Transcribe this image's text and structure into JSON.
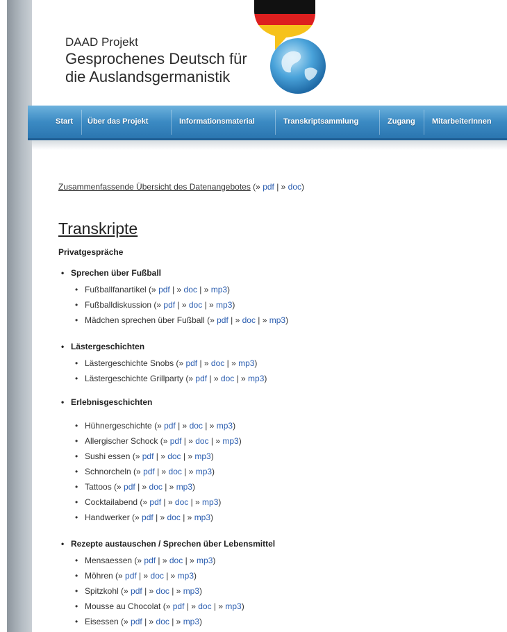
{
  "header": {
    "logo_line1": "DAAD Projekt",
    "logo_line2": "Gesprochenes Deutsch für",
    "logo_line3": "die Auslandsgermanistik"
  },
  "nav": {
    "items": [
      "Start",
      "Über das Projekt",
      "Informationsmaterial",
      "Transkriptsammlung",
      "Zugang",
      "MitarbeiterInnen"
    ]
  },
  "content": {
    "summary_text": "Zusammenfassende Übersicht des Datenangebotes",
    "summary_links": [
      "pdf",
      "doc"
    ],
    "heading": "Transkripte",
    "subheading": "Privatgespräche",
    "groups": [
      {
        "title": "Sprechen über Fußball",
        "items": [
          {
            "name": "Fußballfanartikel",
            "links": [
              "pdf",
              "doc",
              "mp3"
            ]
          },
          {
            "name": "Fußballdiskussion",
            "links": [
              "pdf",
              "doc",
              "mp3"
            ]
          },
          {
            "name": "Mädchen sprechen über Fußball",
            "links": [
              "pdf",
              "doc",
              "mp3"
            ]
          }
        ]
      },
      {
        "title": "Lästergeschichten",
        "items": [
          {
            "name": "Lästergeschichte Snobs",
            "links": [
              "pdf",
              "doc",
              "mp3"
            ]
          },
          {
            "name": "Lästergeschichte Grillparty",
            "links": [
              "pdf",
              "doc",
              "mp3"
            ]
          }
        ]
      },
      {
        "title": "Erlebnisgeschichten",
        "items": [
          {
            "name": "Hühnergeschichte",
            "links": [
              "pdf",
              "doc",
              "mp3"
            ]
          },
          {
            "name": "Allergischer Schock",
            "links": [
              "pdf",
              "doc",
              "mp3"
            ]
          },
          {
            "name": "Sushi essen",
            "links": [
              "pdf",
              "doc",
              "mp3"
            ]
          },
          {
            "name": "Schnorcheln",
            "links": [
              "pdf",
              "doc",
              "mp3"
            ]
          },
          {
            "name": "Tattoos",
            "links": [
              "pdf",
              "doc",
              "mp3"
            ]
          },
          {
            "name": "Cocktailabend",
            "links": [
              "pdf",
              "doc",
              "mp3"
            ]
          },
          {
            "name": "Handwerker",
            "links": [
              "pdf",
              "doc",
              "mp3"
            ]
          }
        ]
      },
      {
        "title": "Rezepte austauschen / Sprechen über Lebensmittel",
        "items": [
          {
            "name": "Mensaessen",
            "links": [
              "pdf",
              "doc",
              "mp3"
            ]
          },
          {
            "name": "Möhren",
            "links": [
              "pdf",
              "doc",
              "mp3"
            ]
          },
          {
            "name": "Spitzkohl",
            "links": [
              "pdf",
              "doc",
              "mp3"
            ]
          },
          {
            "name": "Mousse au Chocolat",
            "links": [
              "pdf",
              "doc",
              "mp3"
            ]
          },
          {
            "name": "Eisessen",
            "links": [
              "pdf",
              "doc",
              "mp3"
            ]
          }
        ]
      }
    ]
  }
}
